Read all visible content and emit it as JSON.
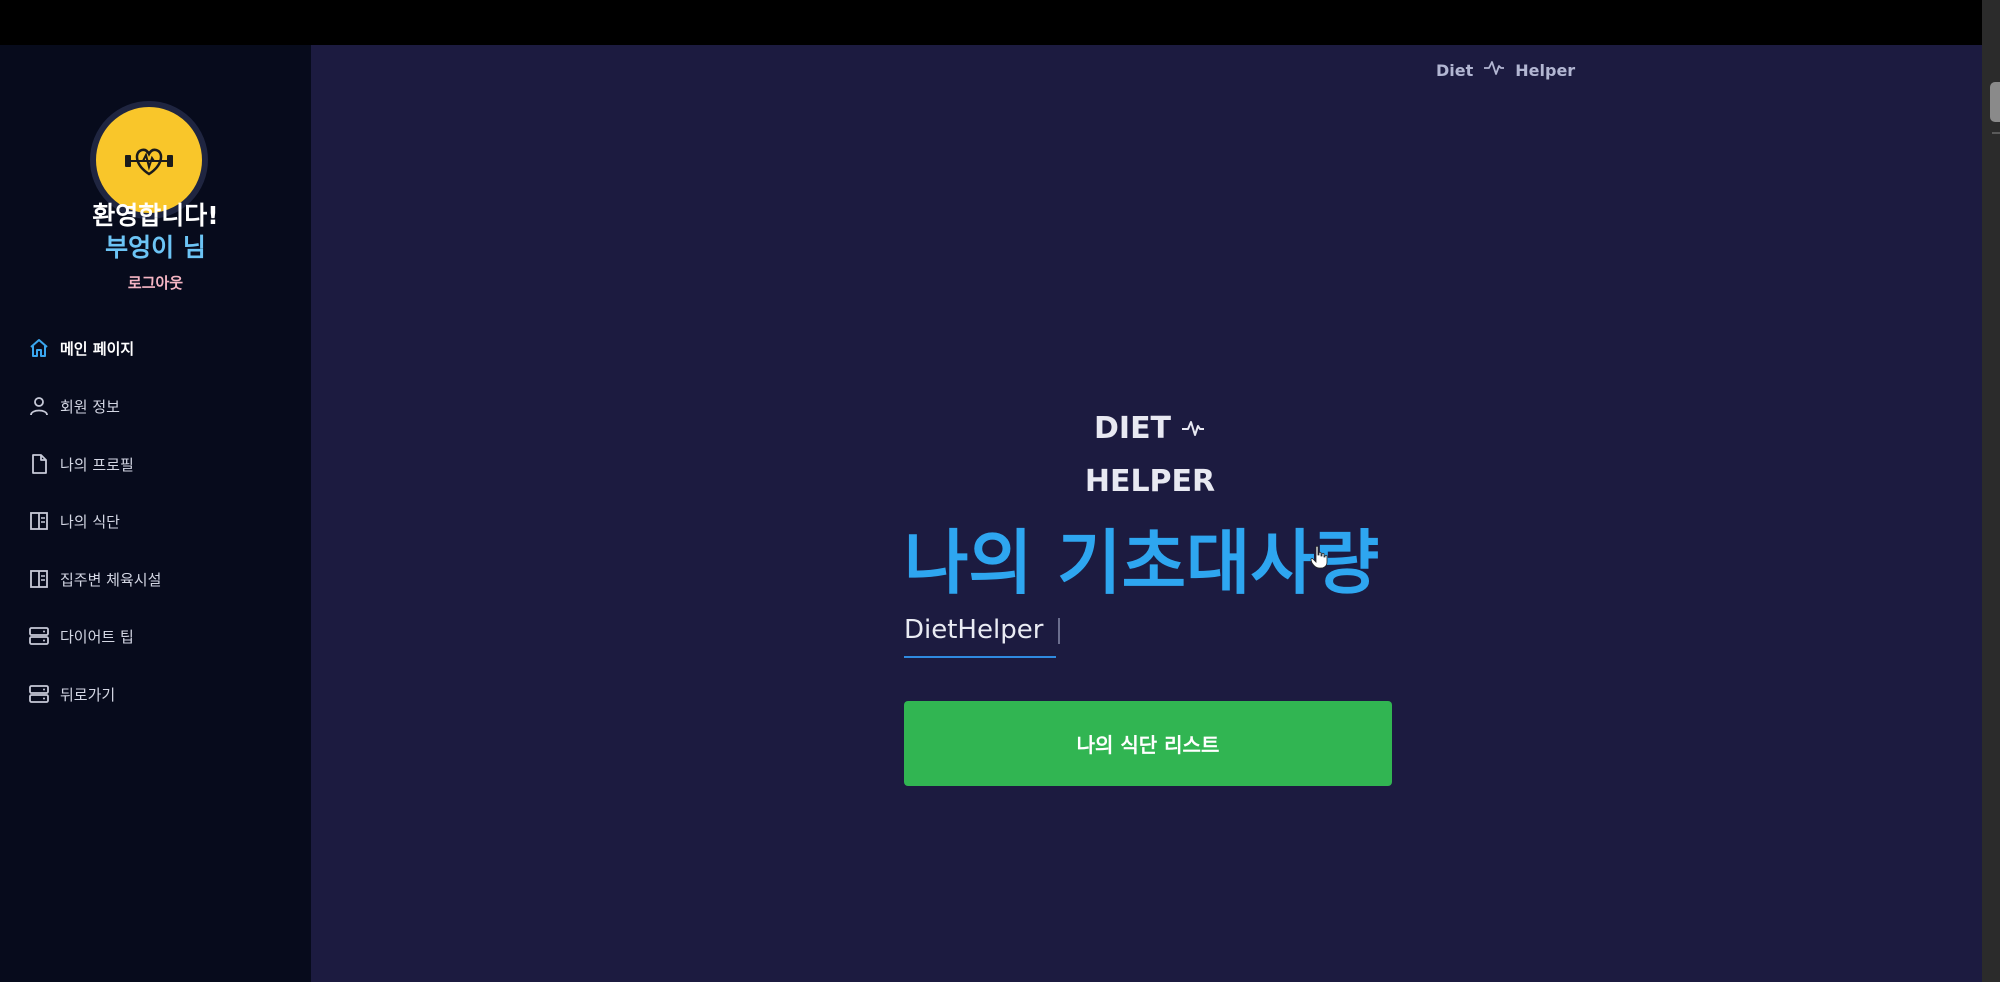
{
  "sidebar": {
    "welcome": "환영합니다!",
    "username": "부엉이 님",
    "logout_label": "로그아웃",
    "items": [
      {
        "label": "메인 페이지",
        "icon": "home-icon"
      },
      {
        "label": "회원 정보",
        "icon": "user-icon"
      },
      {
        "label": "나의 프로필",
        "icon": "document-icon"
      },
      {
        "label": "나의 식단",
        "icon": "book-icon"
      },
      {
        "label": "집주변 체육시설",
        "icon": "book-icon"
      },
      {
        "label": "다이어트 팁",
        "icon": "server-icon"
      },
      {
        "label": "뒤로가기",
        "icon": "server-icon"
      }
    ]
  },
  "header": {
    "brand_left": "Diet",
    "brand_right": "Helper"
  },
  "hero": {
    "line1": "DIET",
    "line2": "HELPER",
    "title": "나의 기초대사량",
    "input_value": "DietHelper",
    "button_label": "나의 식단 리스트"
  },
  "colors": {
    "main_bg": "#1c1b40",
    "sidebar_bg": "#070b1c",
    "accent_blue": "#2ea6f0",
    "button_green": "#31b552",
    "avatar_yellow": "#f9c62a"
  }
}
